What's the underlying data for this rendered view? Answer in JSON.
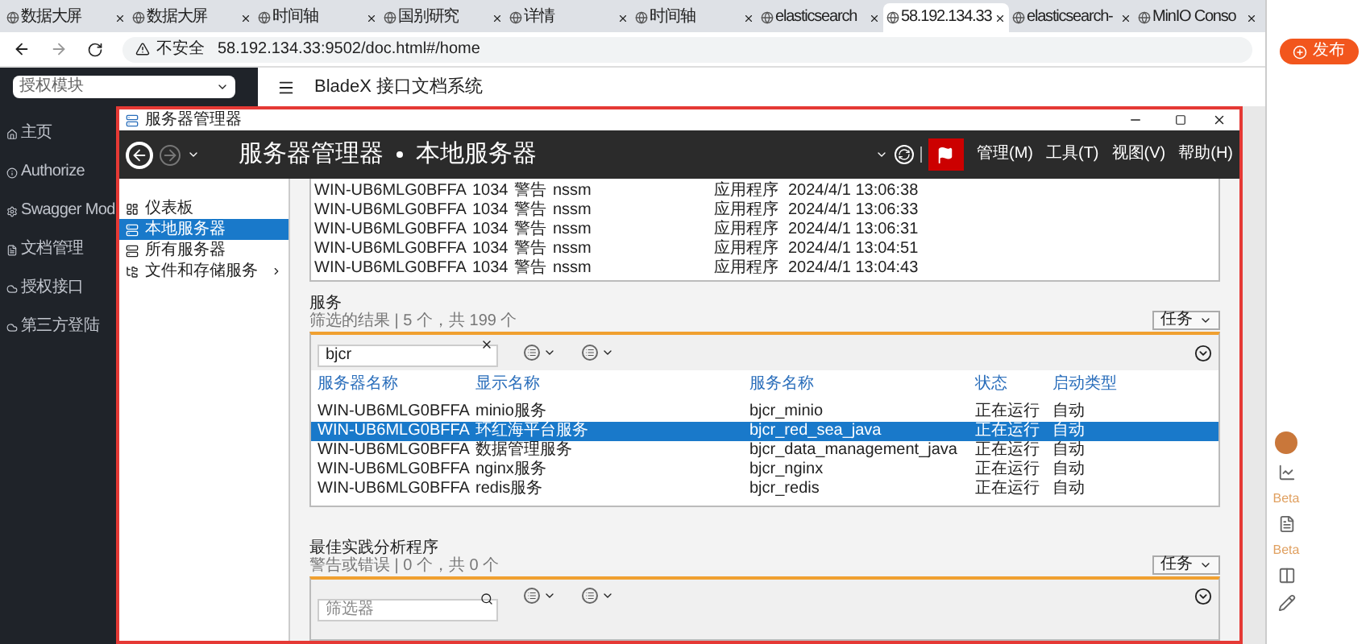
{
  "browser": {
    "tabs": [
      {
        "label": "数据大屏",
        "selected": false
      },
      {
        "label": "数据大屏",
        "selected": false
      },
      {
        "label": "时间轴",
        "selected": false
      },
      {
        "label": "国别研究",
        "selected": false
      },
      {
        "label": "详情",
        "selected": false
      },
      {
        "label": "时间轴",
        "selected": false
      },
      {
        "label": "elasticsearch",
        "selected": false
      },
      {
        "label": "58.192.134.33",
        "selected": true
      },
      {
        "label": "elasticsearch-",
        "selected": false
      },
      {
        "label": "MinIO Conso",
        "selected": false
      }
    ],
    "address": {
      "security": "不安全",
      "url": "58.192.134.33:9502/doc.html#/home"
    }
  },
  "page": {
    "module_select": "授权模块",
    "title": "BladeX 接口文档系统",
    "nav": [
      {
        "label": "主页"
      },
      {
        "label": "Authorize"
      },
      {
        "label": "Swagger Mod"
      },
      {
        "label": "文档管理"
      },
      {
        "label": "授权接口"
      },
      {
        "label": "第三方登陆"
      }
    ]
  },
  "side_panel": {
    "publish_button": "发布",
    "beta_labels": [
      "Beta",
      "Beta"
    ]
  },
  "window": {
    "title": "服务器管理器",
    "breadcrumb": [
      "服务器管理器",
      "本地服务器"
    ],
    "menu": [
      "管理(M)",
      "工具(T)",
      "视图(V)",
      "帮助(H)"
    ],
    "nav": [
      {
        "label": "仪表板",
        "selected": false,
        "has_submenu": false
      },
      {
        "label": "本地服务器",
        "selected": true,
        "has_submenu": false
      },
      {
        "label": "所有服务器",
        "selected": false,
        "has_submenu": false
      },
      {
        "label": "文件和存储服务",
        "selected": false,
        "has_submenu": true
      }
    ],
    "events": [
      [
        "WIN-UB6MLG0BFFA",
        "1034",
        "警告",
        "nssm",
        "应用程序",
        "2024/4/1 13:06:38"
      ],
      [
        "WIN-UB6MLG0BFFA",
        "1034",
        "警告",
        "nssm",
        "应用程序",
        "2024/4/1 13:06:33"
      ],
      [
        "WIN-UB6MLG0BFFA",
        "1034",
        "警告",
        "nssm",
        "应用程序",
        "2024/4/1 13:06:31"
      ],
      [
        "WIN-UB6MLG0BFFA",
        "1034",
        "警告",
        "nssm",
        "应用程序",
        "2024/4/1 13:04:51"
      ],
      [
        "WIN-UB6MLG0BFFA",
        "1034",
        "警告",
        "nssm",
        "应用程序",
        "2024/4/1 13:04:43"
      ]
    ],
    "services": {
      "title": "服务",
      "subtitle": "筛选的结果 | 5 个，共 199 个",
      "tasks_button": "任务",
      "filter": {
        "value": "bjcr"
      },
      "columns": [
        "服务器名称",
        "显示名称",
        "服务名称",
        "状态",
        "启动类型"
      ],
      "rows": [
        {
          "cells": [
            "WIN-UB6MLG0BFFA",
            "minio服务",
            "bjcr_minio",
            "正在运行",
            "自动"
          ],
          "selected": false
        },
        {
          "cells": [
            "WIN-UB6MLG0BFFA",
            "环红海平台服务",
            "bjcr_red_sea_java",
            "正在运行",
            "自动"
          ],
          "selected": true
        },
        {
          "cells": [
            "WIN-UB6MLG0BFFA",
            "数据管理服务",
            "bjcr_data_management_java",
            "正在运行",
            "自动"
          ],
          "selected": false
        },
        {
          "cells": [
            "WIN-UB6MLG0BFFA",
            "nginx服务",
            "bjcr_nginx",
            "正在运行",
            "自动"
          ],
          "selected": false
        },
        {
          "cells": [
            "WIN-UB6MLG0BFFA",
            "redis服务",
            "bjcr_redis",
            "正在运行",
            "自动"
          ],
          "selected": false
        }
      ]
    },
    "bpa": {
      "title": "最佳实践分析程序",
      "subtitle": "警告或错误 | 0 个，共 0 个",
      "tasks_button": "任务",
      "filter": {
        "placeholder": "筛选器"
      }
    }
  }
}
